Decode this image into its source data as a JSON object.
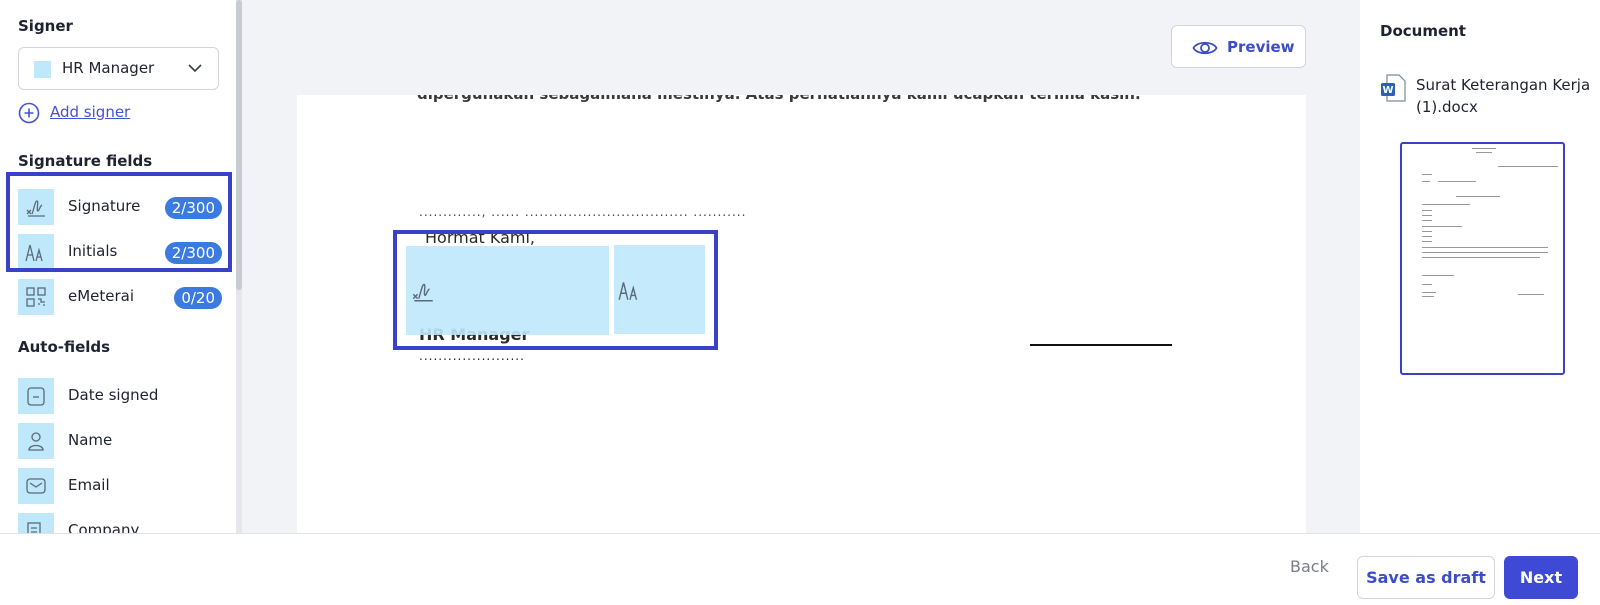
{
  "left_panel": {
    "signer_title": "Signer",
    "signer_select": {
      "value": "HR Manager",
      "swatch_color": "#bfe8fb"
    },
    "add_signer_label": "Add signer",
    "signature_fields_title": "Signature fields",
    "signature_fields": [
      {
        "label": "Signature",
        "count": "2/300",
        "icon": "signature-icon"
      },
      {
        "label": "Initials",
        "count": "2/300",
        "icon": "initials-icon"
      },
      {
        "label": "eMeterai",
        "count": "0/20",
        "icon": "qr-code-icon"
      }
    ],
    "auto_fields_title": "Auto-fields",
    "auto_fields": [
      {
        "label": "Date signed",
        "icon": "calendar-icon"
      },
      {
        "label": "Name",
        "icon": "person-icon"
      },
      {
        "label": "Email",
        "icon": "envelope-icon"
      },
      {
        "label": "Company",
        "icon": "company-icon"
      }
    ]
  },
  "toolbar": {
    "preview_label": "Preview"
  },
  "document": {
    "cut_line": "dipergunakan sebagaimana mestinya.   Atas perhatiannya kami ucapkan terima kasih.",
    "date_placeholder": "............., ...... .................................. ...........",
    "closing": "Hormat Kami,",
    "signer_role": "HR Manager",
    "name_placeholder": "......................"
  },
  "right_panel": {
    "title": "Document",
    "file_name": "Surat Keterangan Kerja (1).docx"
  },
  "footer": {
    "back_label": "Back",
    "draft_label": "Save as draft",
    "next_label": "Next"
  },
  "colors": {
    "accent": "#3e49d6",
    "badge": "#3b7be0",
    "field_fill": "#bfe8fb",
    "selection_border": "#3a41c9"
  }
}
